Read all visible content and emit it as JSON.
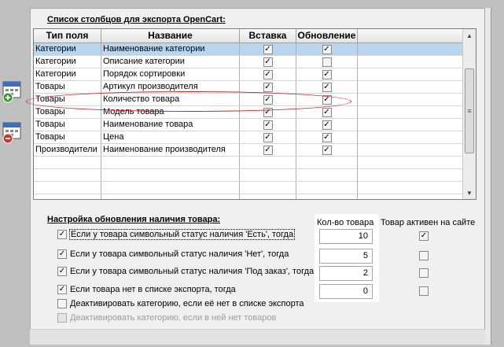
{
  "export": {
    "title": "Список столбцов для экспорта OpenCart:",
    "columns": [
      "Тип поля",
      "Название",
      "Вставка",
      "Обновление"
    ],
    "rows": [
      {
        "type": "Категории",
        "name": "Наименование категории",
        "insert": true,
        "update": true,
        "selected": true
      },
      {
        "type": "Категории",
        "name": "Описание категории",
        "insert": true,
        "update": false
      },
      {
        "type": "Категории",
        "name": "Порядок сортировки",
        "insert": true,
        "update": true
      },
      {
        "type": "Товары",
        "name": "Артикул производителя",
        "insert": true,
        "update": true
      },
      {
        "type": "Товары",
        "name": "Количество товара",
        "insert": true,
        "update": true
      },
      {
        "type": "Товары",
        "name": "Модель товара",
        "insert": true,
        "update": true
      },
      {
        "type": "Товары",
        "name": "Наименование товара",
        "insert": true,
        "update": true
      },
      {
        "type": "Товары",
        "name": "Цена",
        "insert": true,
        "update": true
      },
      {
        "type": "Производители",
        "name": "Наименование производителя",
        "insert": true,
        "update": true
      }
    ],
    "empty_rows": 4
  },
  "stock": {
    "title": "Настройка обновления наличия товара:",
    "qty_header": "Кол-во товара",
    "active_header": "Товар активен на сайте",
    "options": [
      {
        "label": "Если у товара символьный статус наличия 'Есть', тогда",
        "checked": true,
        "qty": "10",
        "active": true,
        "focused": true
      },
      {
        "label": "Если у товара символьный статус наличия 'Нет', тогда",
        "checked": true,
        "qty": "5",
        "active": false
      },
      {
        "label": "Если у товара символьный статус наличия 'Под заказ', тогда",
        "checked": true,
        "qty": "2",
        "active": false
      },
      {
        "label": "Если товара нет в списке экспорта, тогда",
        "checked": true,
        "qty": "0",
        "active": false
      }
    ],
    "extra_options": [
      {
        "label": "Деактивировать категорию, если её нет в списке экспорта",
        "checked": false,
        "disabled": false
      },
      {
        "label": "Деактивировать категорию, если в ней нет товаров",
        "checked": false,
        "disabled": true
      }
    ]
  },
  "icons": {
    "add": "calendar-add-icon",
    "remove": "calendar-remove-icon",
    "check": "✓",
    "scroll_up": "▲",
    "scroll_down": "▼",
    "grip": "≡"
  },
  "colors": {
    "selected_row": "#b8d6f0",
    "highlight_ellipse": "#d02020"
  }
}
